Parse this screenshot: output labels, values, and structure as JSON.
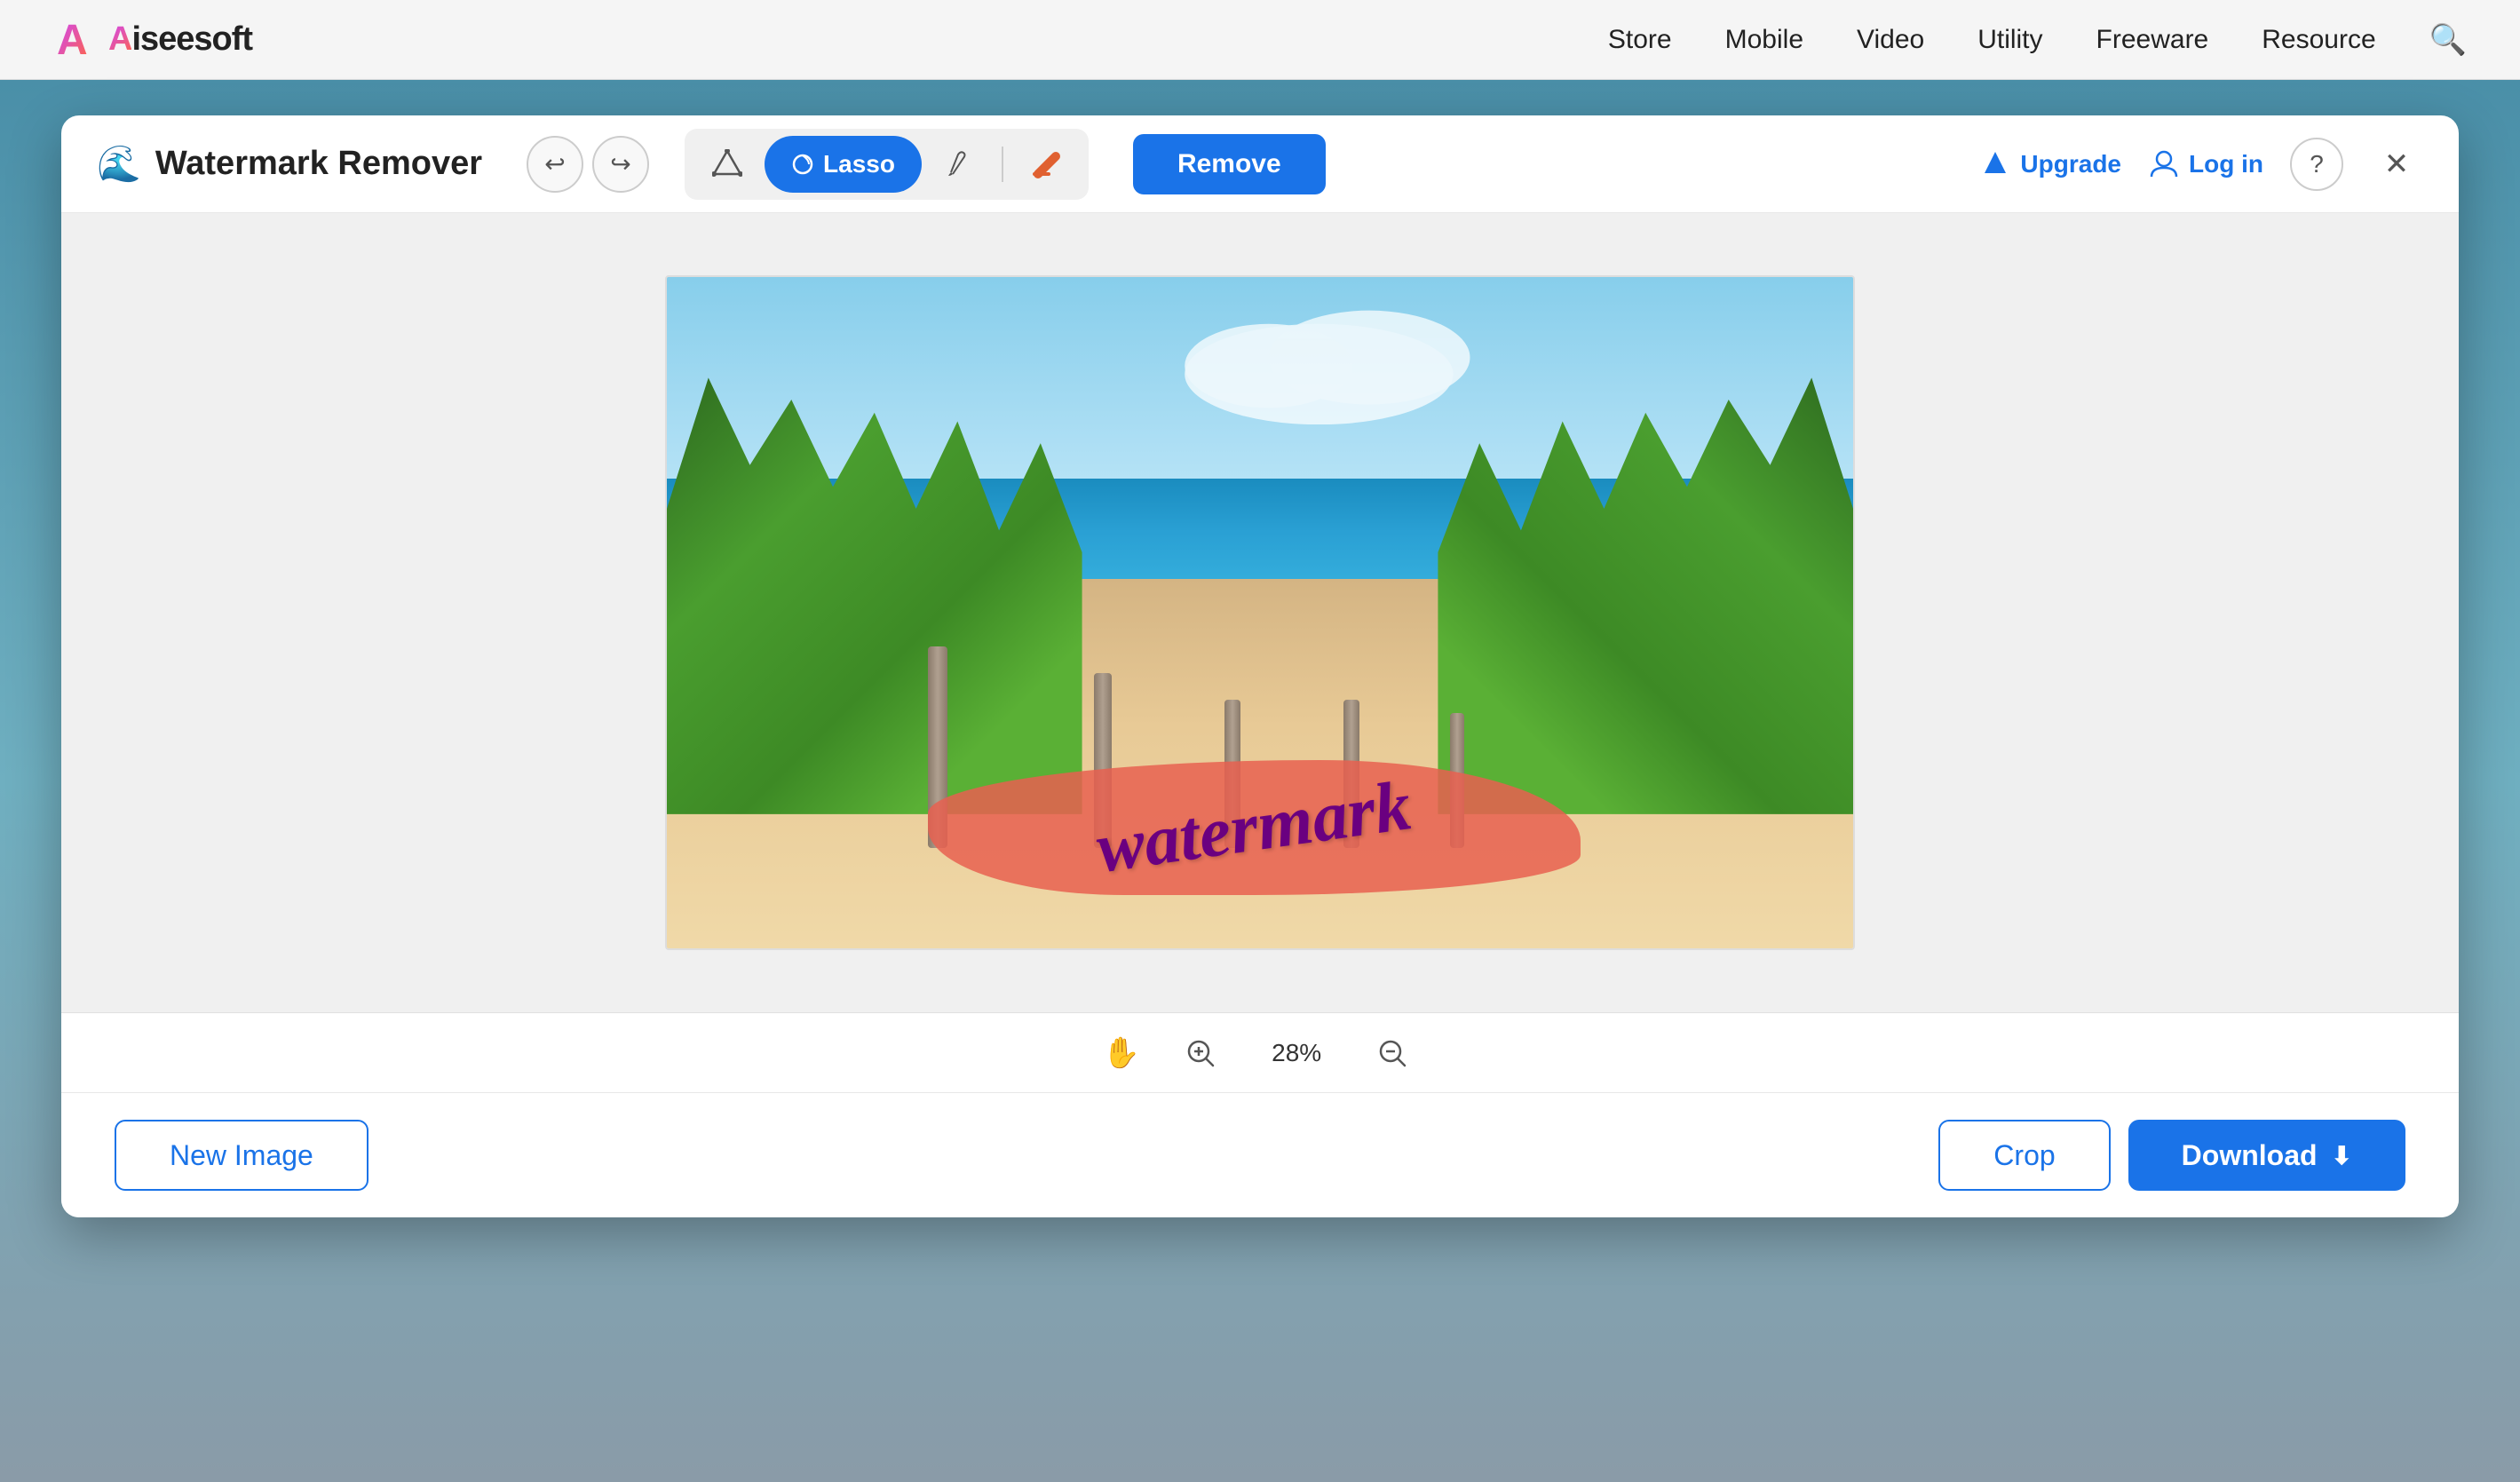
{
  "nav": {
    "logo_text_a": "A",
    "logo_text_rest": "iseesoft",
    "links": [
      "Store",
      "Mobile",
      "Video",
      "Utility",
      "Freeware",
      "Resource"
    ]
  },
  "tool": {
    "title": "Watermark Remover",
    "toolbar": {
      "lasso_label": "Lasso",
      "remove_label": "Remove",
      "upgrade_label": "Upgrade",
      "login_label": "Log in"
    },
    "zoom": {
      "level": "28%"
    },
    "footer": {
      "new_image_label": "New Image",
      "crop_label": "Crop",
      "download_label": "Download"
    }
  }
}
